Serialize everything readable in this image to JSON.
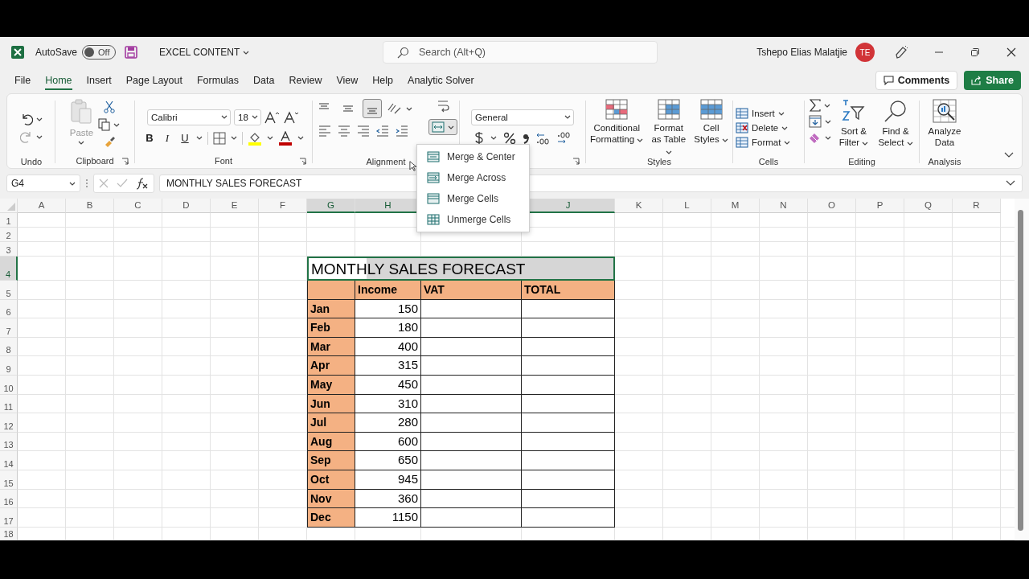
{
  "title_bar": {
    "autosave_label": "AutoSave",
    "autosave_on": false,
    "autosave_state": "Off",
    "file_name": "EXCEL CONTENT",
    "search_placeholder": "Search (Alt+Q)",
    "user_name": "Tshepo Elias Malatjie",
    "user_initials": "TE"
  },
  "tabs": [
    {
      "label": "File",
      "selected": false
    },
    {
      "label": "Home",
      "selected": true
    },
    {
      "label": "Insert",
      "selected": false
    },
    {
      "label": "Page Layout",
      "selected": false
    },
    {
      "label": "Formulas",
      "selected": false
    },
    {
      "label": "Data",
      "selected": false
    },
    {
      "label": "Review",
      "selected": false
    },
    {
      "label": "View",
      "selected": false
    },
    {
      "label": "Help",
      "selected": false
    },
    {
      "label": "Analytic Solver",
      "selected": false
    }
  ],
  "comments_button": "Comments",
  "share_button": "Share",
  "ribbon": {
    "undo": {
      "label": "Undo"
    },
    "clipboard": {
      "label": "Clipboard",
      "paste": "Paste"
    },
    "font": {
      "label": "Font",
      "name": "Calibri",
      "size": "18",
      "format_buttons": [
        "B",
        "I",
        "U"
      ]
    },
    "alignment": {
      "label": "Alignment",
      "vertical": [
        {
          "selected": false
        },
        {
          "selected": false
        },
        {
          "selected": true
        }
      ],
      "merge_open": true
    },
    "number": {
      "format": "General"
    },
    "styles": {
      "label": "Styles",
      "buttons": [
        "Conditional Formatting",
        "Format as Table",
        "Cell Styles"
      ]
    },
    "cells": {
      "label": "Cells",
      "buttons": [
        "Insert",
        "Delete",
        "Format"
      ]
    },
    "editing": {
      "label": "Editing",
      "buttons": [
        "Sort & Filter",
        "Find & Select"
      ]
    },
    "analysis": {
      "label": "Analysis",
      "buttons": [
        "Analyze Data"
      ]
    }
  },
  "merge_menu": [
    {
      "label": "Merge & Center"
    },
    {
      "label": "Merge Across"
    },
    {
      "label": "Merge Cells"
    },
    {
      "label": "Unmerge Cells"
    }
  ],
  "formula_bar": {
    "name_box": "G4",
    "formula": "MONTHLY SALES FORECAST"
  },
  "sheet": {
    "columns": [
      {
        "label": "A",
        "selected": false
      },
      {
        "label": "B",
        "selected": false
      },
      {
        "label": "C",
        "selected": false
      },
      {
        "label": "D",
        "selected": false
      },
      {
        "label": "E",
        "selected": false
      },
      {
        "label": "F",
        "selected": false
      },
      {
        "label": "G",
        "selected": true
      },
      {
        "label": "H",
        "selected": true
      },
      {},
      {
        "label": "J",
        "selected": true
      },
      {
        "label": "K",
        "selected": false
      },
      {
        "label": "L",
        "selected": false
      },
      {
        "label": "M",
        "selected": false
      },
      {
        "label": "N",
        "selected": false
      },
      {
        "label": "O",
        "selected": false
      },
      {
        "label": "P",
        "selected": false
      },
      {
        "label": "Q",
        "selected": false
      },
      {
        "label": "R",
        "selected": false
      }
    ],
    "rows": [
      {
        "label": "1",
        "selected": false
      },
      {
        "label": "2",
        "selected": false
      },
      {
        "label": "3",
        "selected": false
      },
      {
        "label": "4",
        "selected": true
      },
      {
        "label": "5",
        "selected": false
      },
      {
        "label": "6",
        "selected": false
      },
      {
        "label": "7",
        "selected": false
      },
      {
        "label": "8",
        "selected": false
      },
      {
        "label": "9",
        "selected": false
      },
      {
        "label": "10",
        "selected": false
      },
      {
        "label": "11",
        "selected": false
      },
      {
        "label": "12",
        "selected": false
      },
      {
        "label": "13",
        "selected": false
      },
      {
        "label": "14",
        "selected": false
      },
      {
        "label": "15",
        "selected": false
      },
      {
        "label": "16",
        "selected": false
      },
      {
        "label": "17",
        "selected": false
      },
      {
        "label": "18",
        "selected": false
      }
    ],
    "table": {
      "title": "MONTHLY SALES FORECAST",
      "headers": [
        "Income",
        "VAT",
        "TOTAL"
      ],
      "rows": [
        {
          "month": "Jan",
          "income": "150"
        },
        {
          "month": "Feb",
          "income": "180"
        },
        {
          "month": "Mar",
          "income": "400"
        },
        {
          "month": "Apr",
          "income": "315"
        },
        {
          "month": "May",
          "income": "450"
        },
        {
          "month": "Jun",
          "income": "310"
        },
        {
          "month": "Jul",
          "income": "280"
        },
        {
          "month": "Aug",
          "income": "600"
        },
        {
          "month": "Sep",
          "income": "650"
        },
        {
          "month": "Oct",
          "income": "945"
        },
        {
          "month": "Nov",
          "income": "360"
        },
        {
          "month": "Dec",
          "income": "1150"
        }
      ]
    }
  }
}
